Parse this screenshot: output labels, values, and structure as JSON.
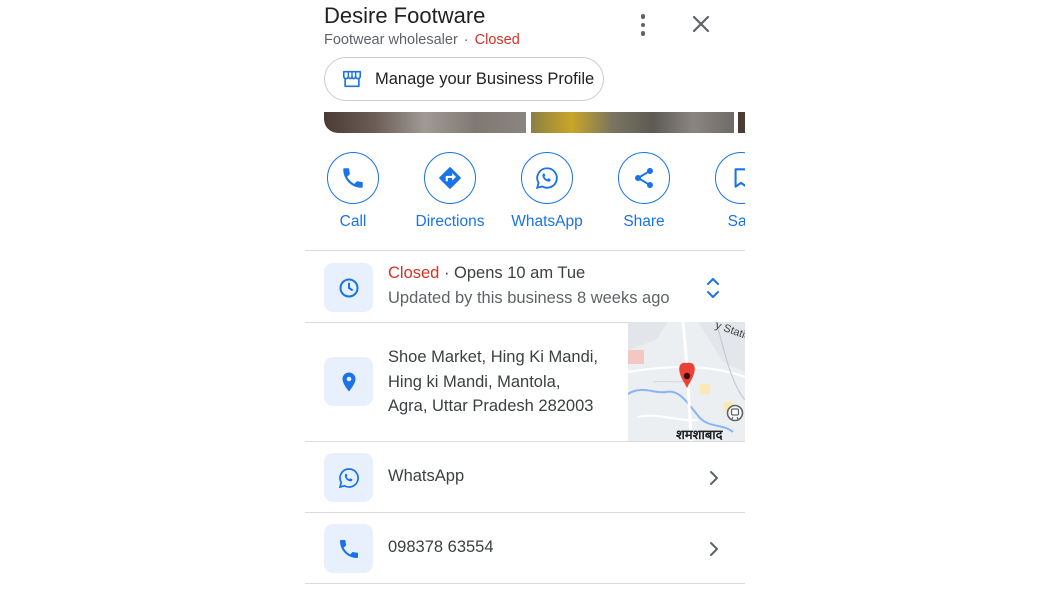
{
  "business": {
    "name": "Desire Footware",
    "category": "Footwear wholesaler",
    "separator": "·",
    "status": "Closed"
  },
  "manage_profile": {
    "label": "Manage your Business Profile"
  },
  "actions": [
    {
      "label": "Call",
      "icon": "phone-icon"
    },
    {
      "label": "Directions",
      "icon": "directions-icon"
    },
    {
      "label": "WhatsApp",
      "icon": "whatsapp-icon"
    },
    {
      "label": "Share",
      "icon": "share-icon"
    },
    {
      "label": "Sav",
      "icon": "bookmark-icon"
    }
  ],
  "hours": {
    "status": "Closed",
    "opens": " · Opens 10 am Tue",
    "updated": "Updated by this business 8 weeks ago"
  },
  "address": {
    "lines": [
      "Shoe Market, Hing Ki Mandi,",
      "Hing ki Mandi, Mantola,",
      "Agra, Uttar Pradesh 282003"
    ]
  },
  "map": {
    "label_station": "y Statio",
    "label_area": "शमशाबाद"
  },
  "whatsapp_row": {
    "label": "WhatsApp"
  },
  "phone_row": {
    "number": "098378 63554"
  },
  "colors": {
    "accent": "#1a73e8",
    "closed": "#d93025",
    "icon_bg": "#e8f0fe",
    "pin": "#ea4335"
  }
}
